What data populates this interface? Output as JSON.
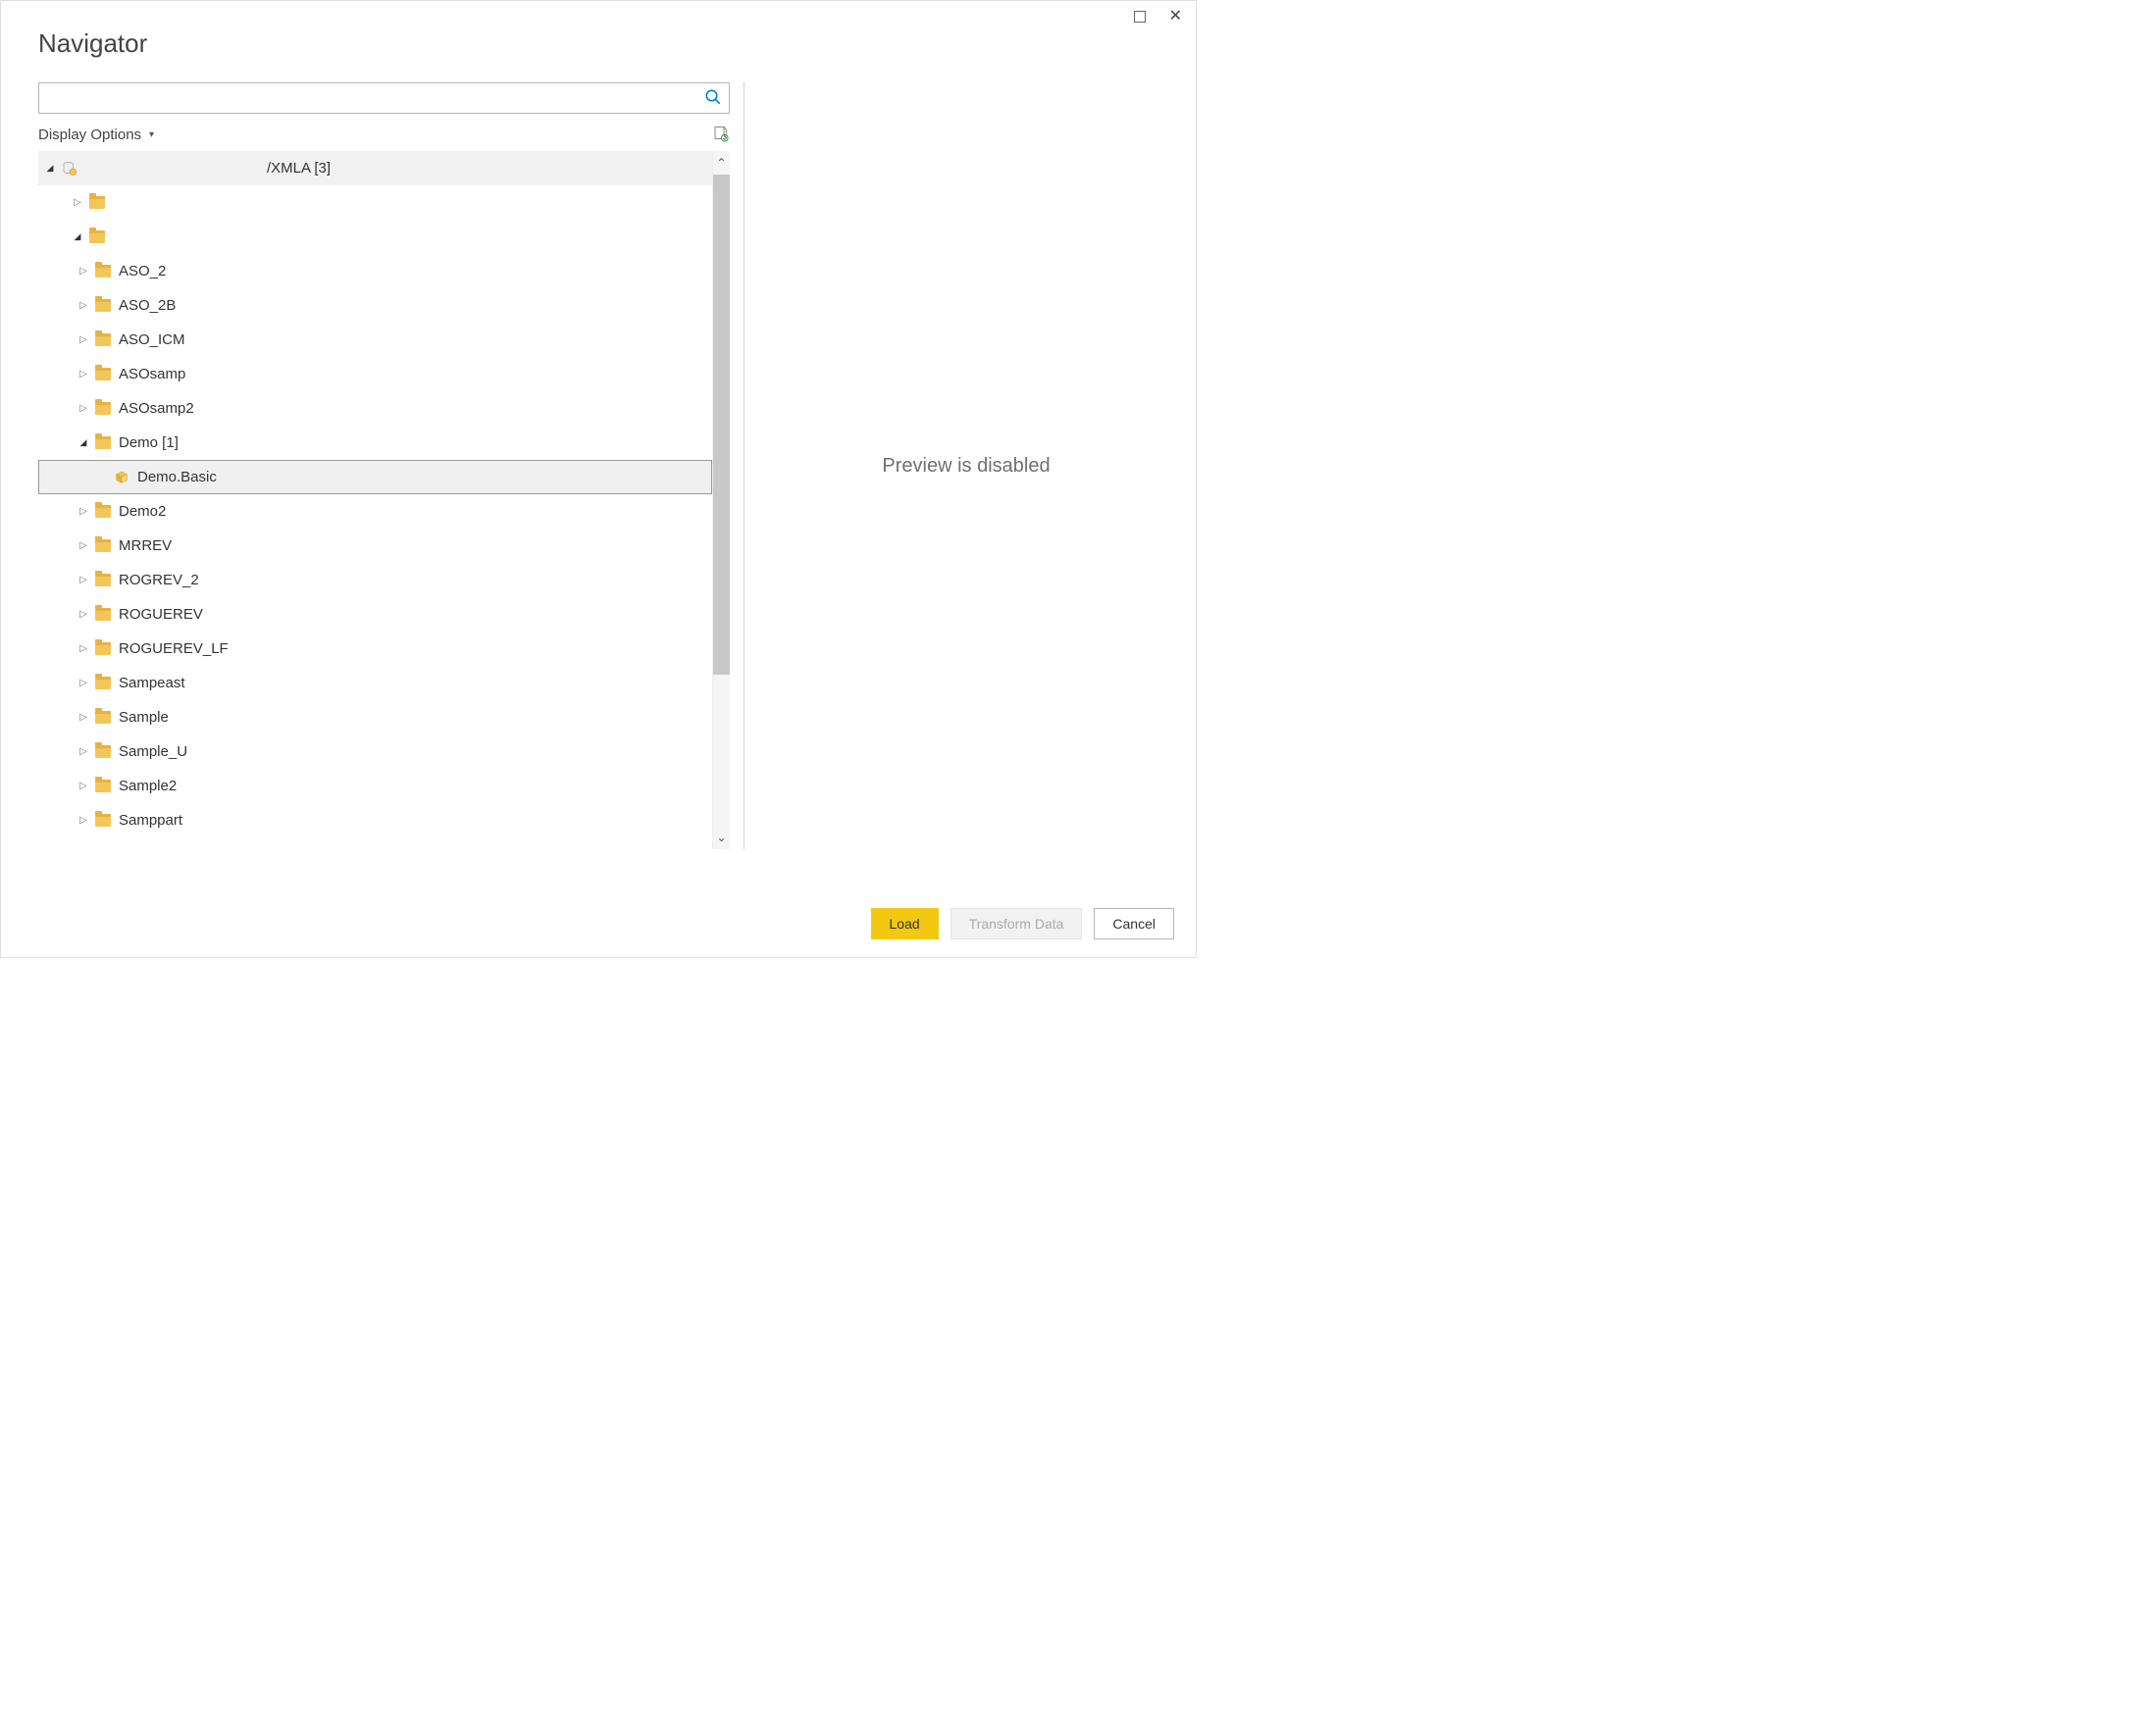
{
  "window": {
    "title": "Navigator"
  },
  "toolbar": {
    "display_options_label": "Display Options"
  },
  "search": {
    "placeholder": ""
  },
  "tree": {
    "root_label": "/XMLA [3]",
    "items": [
      {
        "label": "",
        "level": 1,
        "expanded": false,
        "icon": "folder"
      },
      {
        "label": "",
        "level": 1,
        "expanded": true,
        "icon": "folder"
      },
      {
        "label": "ASO_2",
        "level": 2,
        "expanded": false,
        "icon": "folder"
      },
      {
        "label": "ASO_2B",
        "level": 2,
        "expanded": false,
        "icon": "folder"
      },
      {
        "label": "ASO_ICM",
        "level": 2,
        "expanded": false,
        "icon": "folder"
      },
      {
        "label": "ASOsamp",
        "level": 2,
        "expanded": false,
        "icon": "folder"
      },
      {
        "label": "ASOsamp2",
        "level": 2,
        "expanded": false,
        "icon": "folder"
      },
      {
        "label": "Demo [1]",
        "level": 2,
        "expanded": true,
        "icon": "folder"
      },
      {
        "label": "Demo.Basic",
        "level": 3,
        "icon": "cube",
        "selected": true
      },
      {
        "label": "Demo2",
        "level": 2,
        "expanded": false,
        "icon": "folder"
      },
      {
        "label": "MRREV",
        "level": 2,
        "expanded": false,
        "icon": "folder"
      },
      {
        "label": "ROGREV_2",
        "level": 2,
        "expanded": false,
        "icon": "folder"
      },
      {
        "label": "ROGUEREV",
        "level": 2,
        "expanded": false,
        "icon": "folder"
      },
      {
        "label": "ROGUEREV_LF",
        "level": 2,
        "expanded": false,
        "icon": "folder"
      },
      {
        "label": "Sampeast",
        "level": 2,
        "expanded": false,
        "icon": "folder"
      },
      {
        "label": "Sample",
        "level": 2,
        "expanded": false,
        "icon": "folder"
      },
      {
        "label": "Sample_U",
        "level": 2,
        "expanded": false,
        "icon": "folder"
      },
      {
        "label": "Sample2",
        "level": 2,
        "expanded": false,
        "icon": "folder"
      },
      {
        "label": "Samppart",
        "level": 2,
        "expanded": false,
        "icon": "folder"
      }
    ]
  },
  "preview": {
    "message": "Preview is disabled"
  },
  "footer": {
    "load_label": "Load",
    "transform_label": "Transform Data",
    "cancel_label": "Cancel"
  }
}
